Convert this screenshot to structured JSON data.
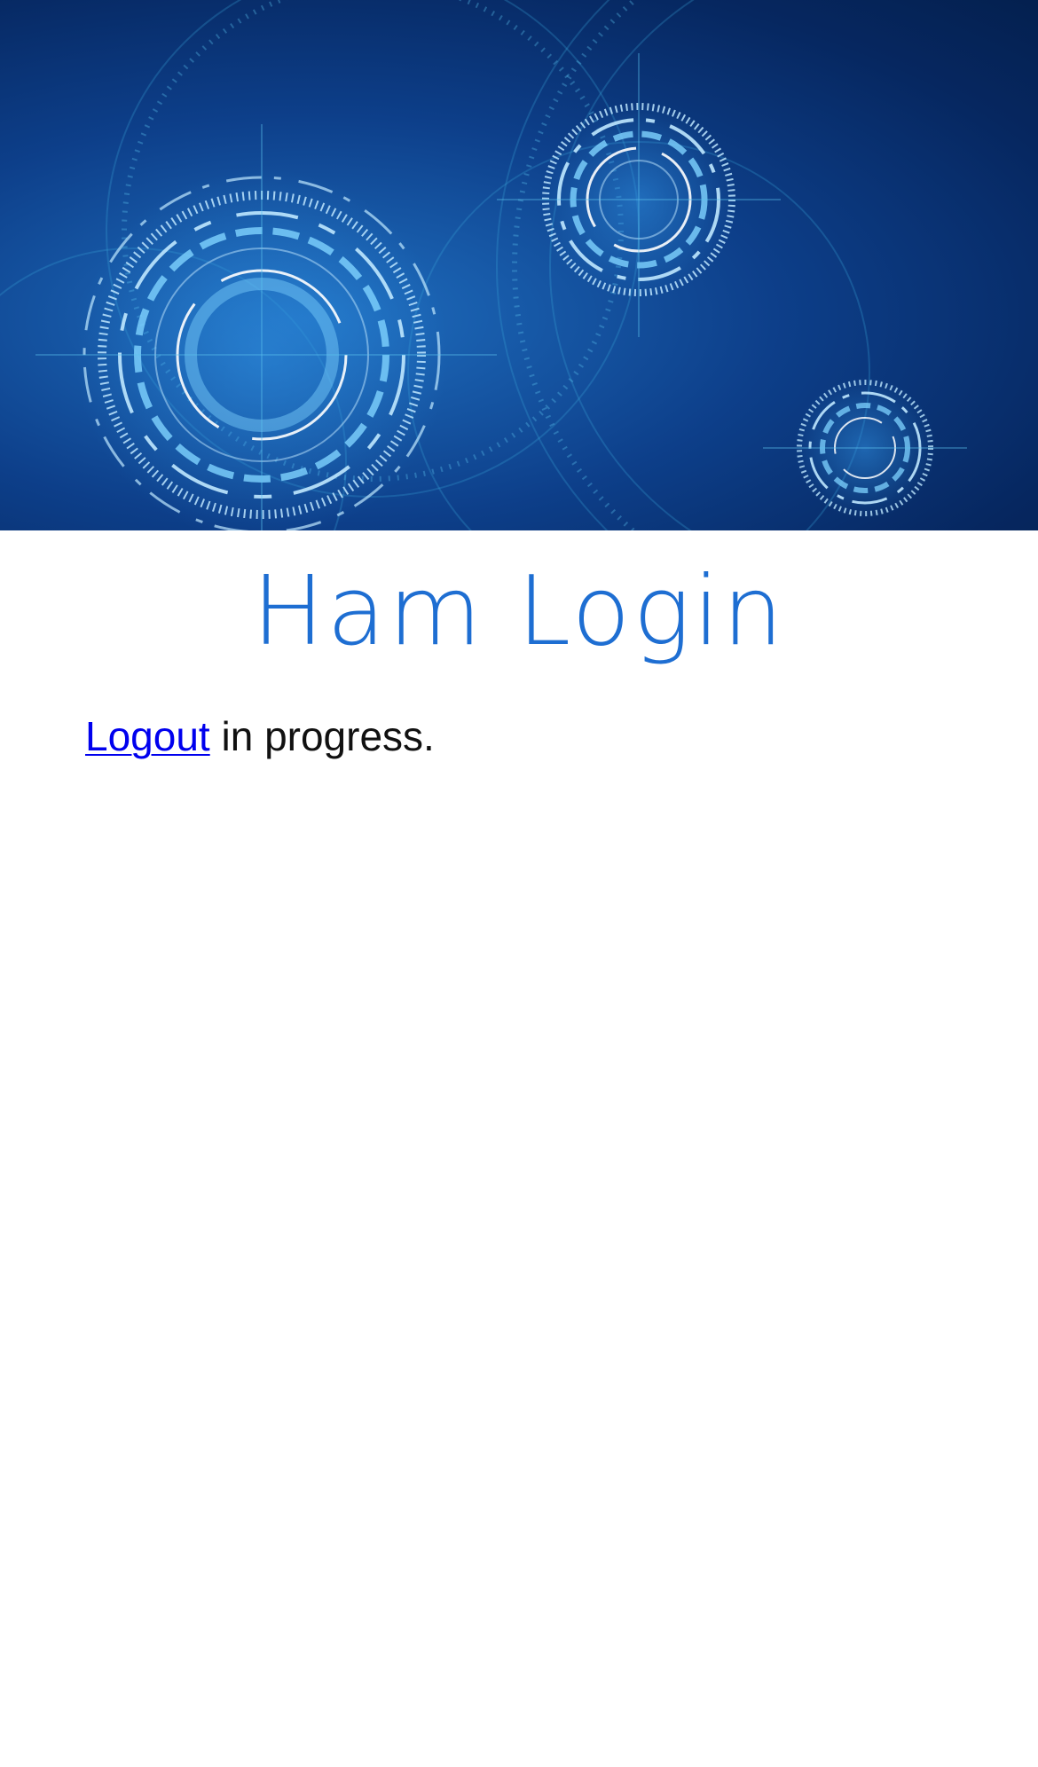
{
  "header": {
    "banner_alt": "technology circles banner",
    "title": "Ham Login"
  },
  "main": {
    "logout_link": "Logout",
    "status_suffix": " in progress."
  },
  "colors": {
    "title": "#1e6ed2",
    "link": "#0000ee",
    "text": "#111111",
    "banner_dark": "#062760",
    "banner_light": "#1f6fc0"
  }
}
